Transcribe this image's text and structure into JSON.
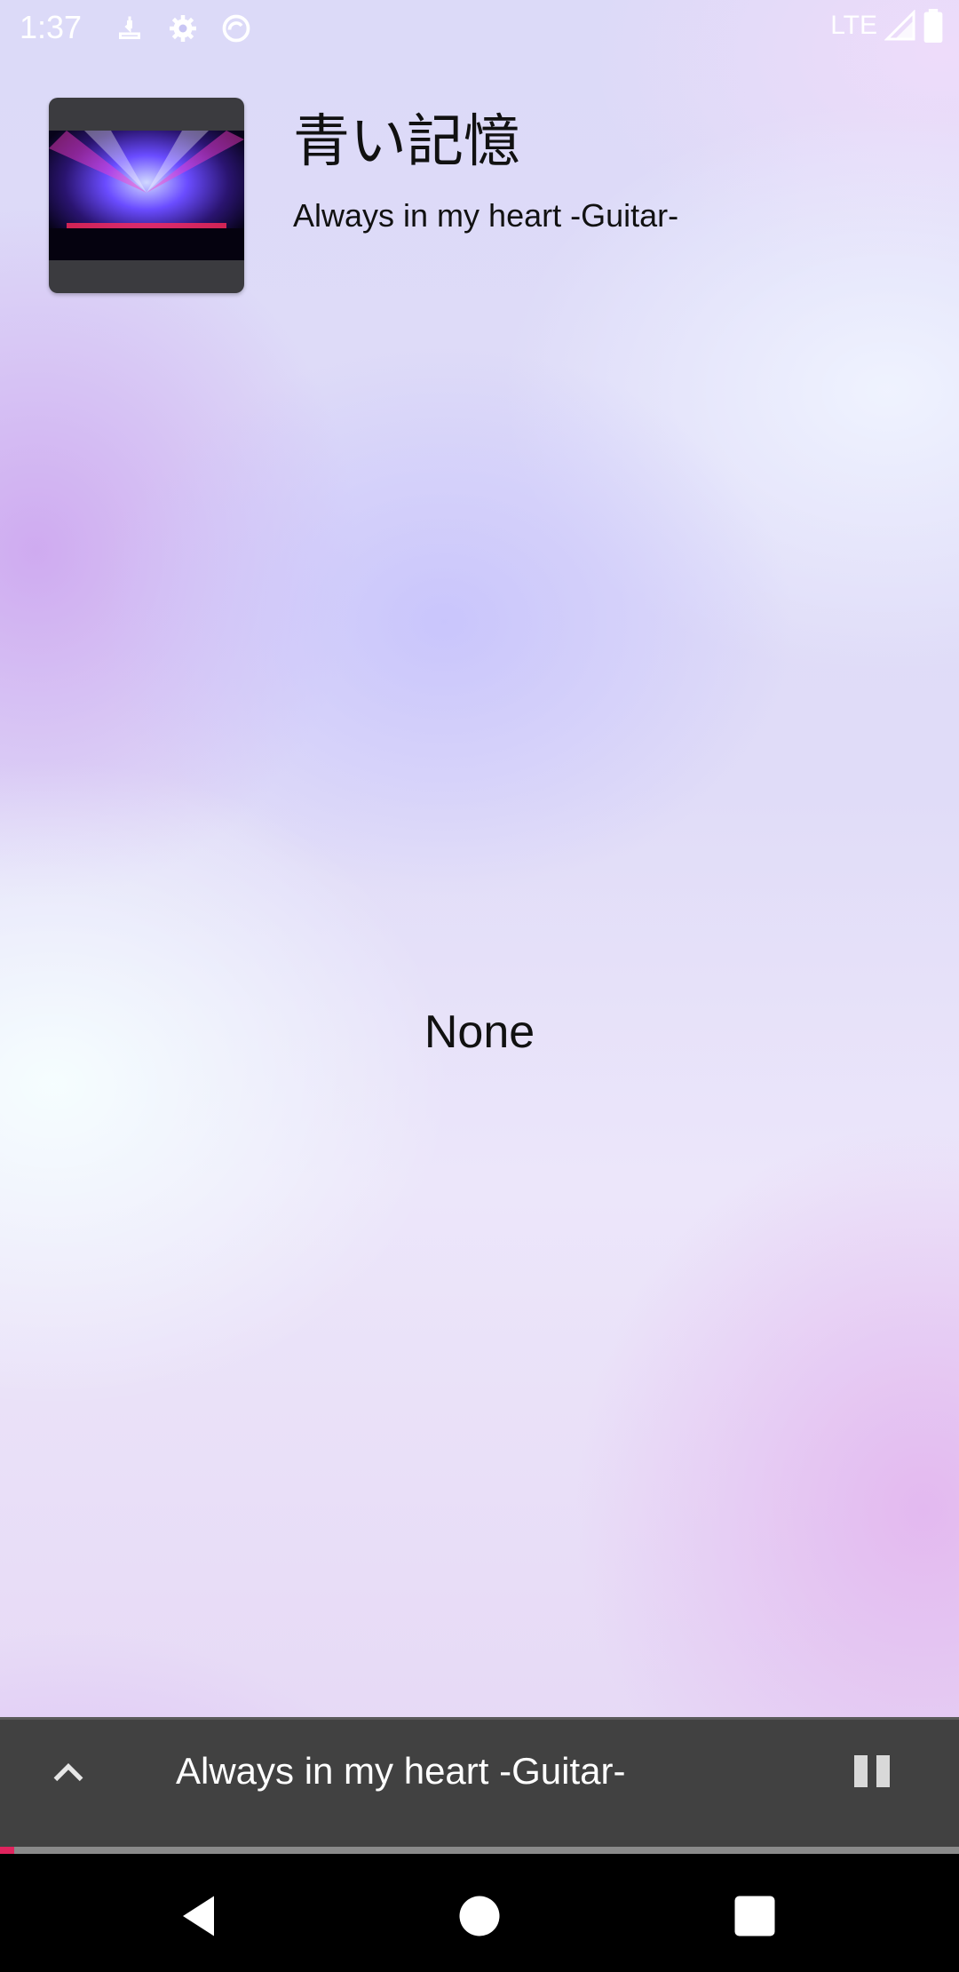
{
  "status_bar": {
    "time": "1:37",
    "network": "LTE",
    "icons": [
      "download-icon",
      "settings-icon",
      "sync-icon",
      "signal-icon",
      "battery-icon"
    ]
  },
  "now_playing": {
    "title": "青い記憶",
    "subtitle": "Always in my heart -Guitar-",
    "album_art": "concert-stage-image"
  },
  "content": {
    "message": "None"
  },
  "mini_player": {
    "title": "Always in my heart -Guitar-",
    "progress": 0.015,
    "progress_color": "#e0245e",
    "expand_icon": "chevron-up-icon",
    "pause_icon": "pause-icon"
  },
  "nav_bar": {
    "buttons": [
      "back-icon",
      "home-icon",
      "recents-icon"
    ]
  }
}
